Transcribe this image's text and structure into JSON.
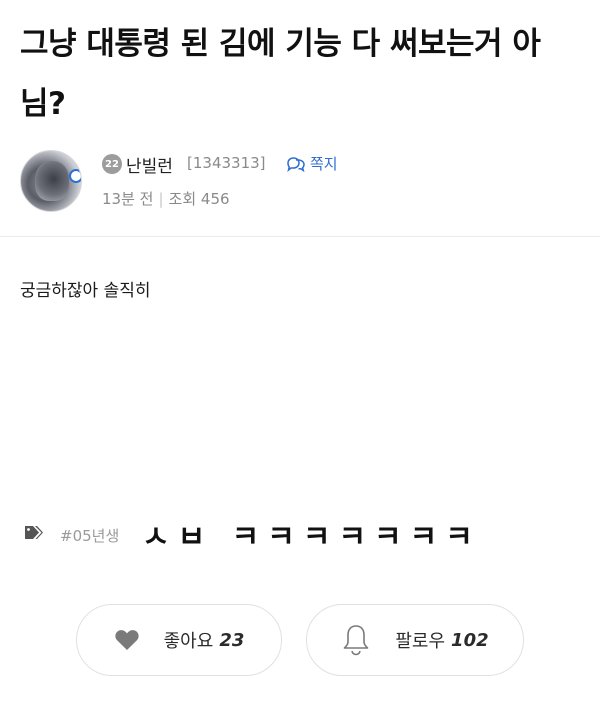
{
  "post": {
    "title": "그냥 대통령 된 김에 기능 다 써보는거 아님?",
    "body": "궁금하잖아 솔직히"
  },
  "author": {
    "level": "22",
    "nickname": "난빌런",
    "user_id": "[1343313]",
    "message_label": "쪽지",
    "time_ago": "13분 전",
    "views_label": "조회 456"
  },
  "tags": {
    "tag": "#05년생",
    "overlay_text": "ㅅㅂ ㅋㅋㅋㅋㅋㅋㅋ"
  },
  "actions": {
    "like_label": "좋아요",
    "like_count": "23",
    "follow_label": "팔로우",
    "follow_count": "102"
  },
  "icons": {
    "message": "chat-bubbles-icon",
    "tag": "tag-icon",
    "like": "heart-icon",
    "follow": "bell-icon"
  },
  "colors": {
    "accent": "#2f6fd1",
    "muted_text": "#8a8a8a",
    "badge_gray": "#9c9c9c"
  }
}
